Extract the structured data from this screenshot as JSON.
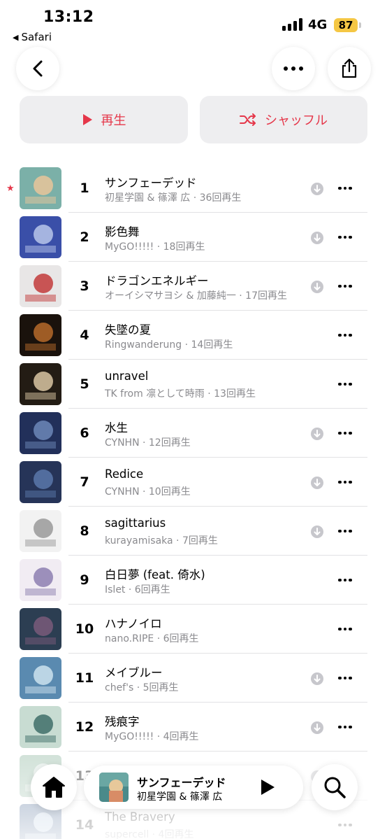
{
  "status_bar": {
    "time": "13:12",
    "back_app": "Safari",
    "network": "4G",
    "battery": "87"
  },
  "actions": {
    "play_label": "再生",
    "shuffle_label": "シャッフル"
  },
  "accent_color": "#e5374a",
  "tracks": [
    {
      "rank": "1",
      "title": "サンフェーデッド",
      "subtitle": "初星学園 & 篠澤 広 · 36回再生",
      "downloaded": true,
      "starred": true
    },
    {
      "rank": "2",
      "title": "影色舞",
      "subtitle": "MyGO!!!!! · 18回再生",
      "downloaded": true
    },
    {
      "rank": "3",
      "title": "ドラゴンエネルギー",
      "subtitle": "オーイシマサヨシ & 加藤純一 · 17回再生",
      "downloaded": true
    },
    {
      "rank": "4",
      "title": "失墜の夏",
      "subtitle": "Ringwanderung · 14回再生",
      "downloaded": false
    },
    {
      "rank": "5",
      "title": "unravel",
      "subtitle": "TK from 凛として時雨 · 13回再生",
      "downloaded": false
    },
    {
      "rank": "6",
      "title": "水生",
      "subtitle": "CYNHN · 12回再生",
      "downloaded": true
    },
    {
      "rank": "7",
      "title": "Redice",
      "subtitle": "CYNHN · 10回再生",
      "downloaded": true
    },
    {
      "rank": "8",
      "title": "sagittarius",
      "subtitle": "kurayamisaka · 7回再生",
      "downloaded": true
    },
    {
      "rank": "9",
      "title": "白日夢 (feat. 倚水)",
      "subtitle": "Islet · 6回再生",
      "downloaded": false
    },
    {
      "rank": "10",
      "title": "ハナノイロ",
      "subtitle": "nano.RIPE · 6回再生",
      "downloaded": false
    },
    {
      "rank": "11",
      "title": "メイブルー",
      "subtitle": "chef's · 5回再生",
      "downloaded": true
    },
    {
      "rank": "12",
      "title": "残痕字",
      "subtitle": "MyGO!!!!! · 4回再生",
      "downloaded": true
    },
    {
      "rank": "13",
      "title": "",
      "subtitle": "",
      "downloaded": true
    },
    {
      "rank": "14",
      "title": "The Bravery",
      "subtitle": "supercell · 4回再生",
      "downloaded": false
    }
  ],
  "mini_player": {
    "title": "サンフェーデッド",
    "artist": "初星学園 & 篠澤 広"
  },
  "icons": [
    "back-chevron-icon",
    "more-icon",
    "share-icon",
    "play-icon",
    "shuffle-icon",
    "download-icon",
    "star-icon",
    "home-icon",
    "search-icon"
  ]
}
